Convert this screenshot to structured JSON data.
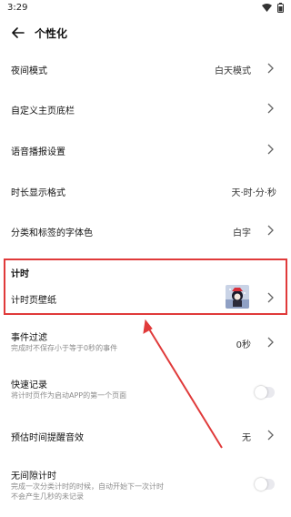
{
  "status": {
    "time": "3:29"
  },
  "header": {
    "title": "个性化"
  },
  "settings": [
    {
      "label": "夜间模式",
      "value": "白天模式"
    },
    {
      "label": "自定义主页底栏"
    },
    {
      "label": "语音播报设置"
    },
    {
      "label": "时长显示格式",
      "value": "天·时·分·秒"
    },
    {
      "label": "分类和标签的字体色",
      "value": "白字"
    }
  ],
  "timing": {
    "section_title": "计时",
    "wallpaper_label": "计时页壁纸",
    "event_filter": {
      "label": "事件过滤",
      "sub": "完成时不保存小于等于0秒的事件",
      "value": "0秒"
    },
    "quick_record": {
      "label": "快速记录",
      "sub": "将计时页作为启动APP的第一个页面",
      "toggle_on": false
    },
    "estimate_sound": {
      "label": "预估时间提醒音效",
      "value": "无"
    },
    "seamless": {
      "label": "无间隙计时",
      "sub1": "完成一次分类计时的时候，自动开始下一次计时",
      "sub2": "不会产生几秒的未记录",
      "toggle_on": false
    }
  },
  "colors": {
    "highlight": "#e03a3a",
    "arrow": "#e03a3a"
  }
}
